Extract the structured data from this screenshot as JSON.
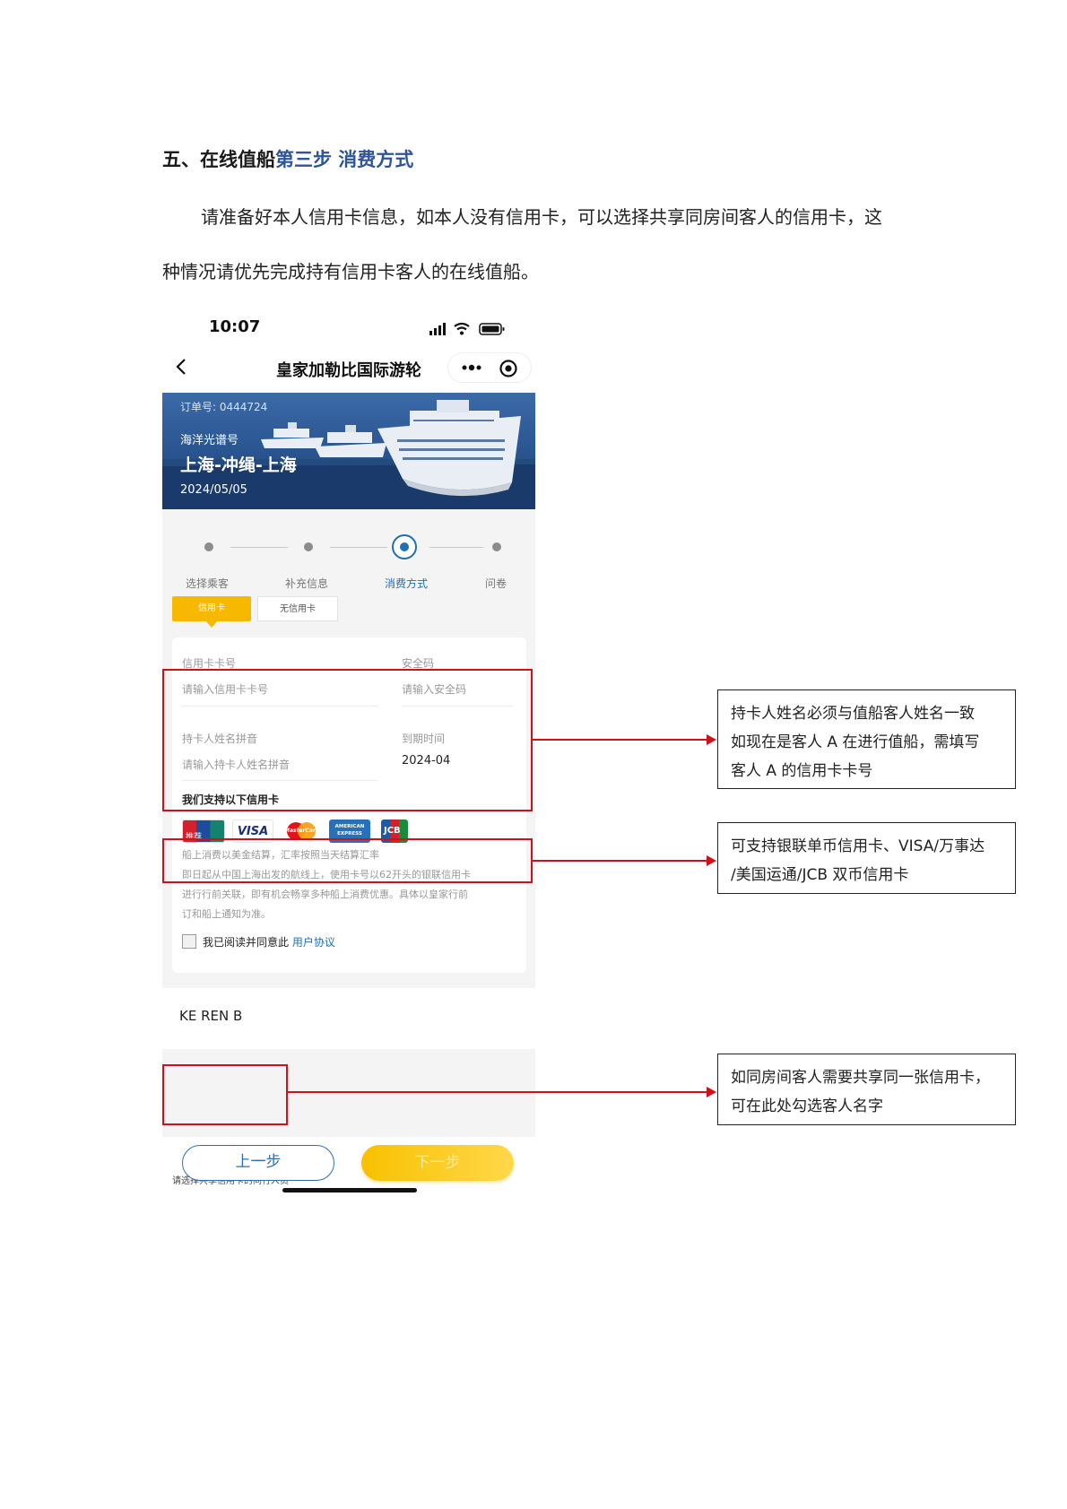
{
  "doc": {
    "heading_black": "五、在线值船",
    "heading_blue": "第三步  消费方式",
    "para_line1": "请准备好本人信用卡信息，如本人没有信用卡，可以选择共享同房间客人的信用卡，这",
    "para_line2": "种情况请优先完成持有信用卡客人的在线值船。"
  },
  "status_bar": {
    "time": "10:07"
  },
  "nav": {
    "title": "皇家加勒比国际游轮"
  },
  "banner": {
    "order_no": "订单号: 0444724",
    "ship": "海洋光谱号",
    "route": "上海-冲绳-上海",
    "date": "2024/05/05"
  },
  "steps": [
    {
      "label": "选择乘客",
      "active": false
    },
    {
      "label": "补充信息",
      "active": false
    },
    {
      "label": "消费方式",
      "active": true
    },
    {
      "label": "问卷",
      "active": false
    }
  ],
  "tabs": {
    "credit": "信用卡",
    "no_credit": "无信用卡"
  },
  "form": {
    "card_no_label": "信用卡卡号",
    "card_no_placeholder": "请输入信用卡卡号",
    "cvv_label": "安全码",
    "cvv_placeholder": "请输入安全码",
    "name_label": "持卡人姓名拼音",
    "name_placeholder": "请输入持卡人姓名拼音",
    "expiry_label": "到期时间",
    "expiry_value": "2024-04",
    "support_title": "我们支持以下信用卡",
    "cards": {
      "unionpay_badge": "推荐",
      "visa": "VISA",
      "mastercard": "MasterCard",
      "amex": "AMERICAN EXPRESS",
      "jcb": "JCB"
    },
    "note_lines": [
      "船上消费以美金结算，汇率按照当天结算汇率",
      "即日起从中国上海出发的航线上，使用卡号以62开头的银联信用卡",
      "进行行前关联，即有机会畅享多种船上消费优惠。具体以皇家行前",
      "订和船上通知为准。"
    ],
    "agree_text": "我已阅读并同意此 ",
    "agree_link": "用户协议"
  },
  "share": {
    "label": "请选择共享信用卡的同行人员",
    "name": "KE REN B"
  },
  "buttons": {
    "prev": "上一步",
    "next": "下一步"
  },
  "callouts": [
    {
      "lines": [
        "持卡人姓名必须与值船客人姓名一致",
        "如现在是客人 A 在进行值船，需填写",
        "客人 A 的信用卡卡号"
      ]
    },
    {
      "lines": [
        "可支持银联单币信用卡、VISA/万事达",
        "/美国运通/JCB 双币信用卡"
      ]
    },
    {
      "lines": [
        "如同房间客人需要共享同一张信用卡，",
        "可在此处勾选客人名字"
      ]
    }
  ],
  "colors": {
    "accent_blue": "#1f6fb5",
    "yellow": "#f6b900",
    "annotation_red": "#d0101b"
  }
}
